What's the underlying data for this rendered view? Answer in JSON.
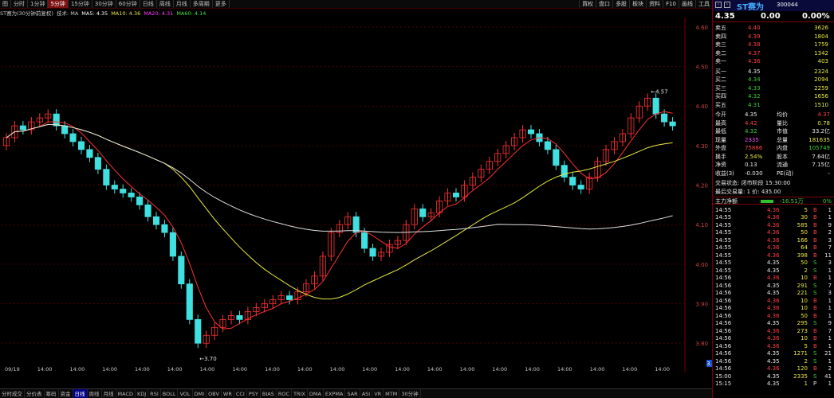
{
  "topbar": {
    "tabs": [
      "图",
      "分时",
      "1分钟",
      "5分钟",
      "15分钟",
      "30分钟",
      "60分钟",
      "日线",
      "周线",
      "月线",
      "多周期",
      "更多"
    ],
    "tools": [
      "買权",
      "盘口",
      "多股",
      "板块",
      "资料",
      "F10",
      "画线",
      "工具"
    ]
  },
  "indicator_line": [
    {
      "text": "ST赛为(30分钟前复权)",
      "color": "#c8c8c8"
    },
    {
      "text": "技术: MA",
      "color": "#c8c8c8"
    },
    {
      "text": "MA5: 4.35",
      "color": "#ffffff"
    },
    {
      "text": "MA10: 4.36",
      "color": "#e8e840"
    },
    {
      "text": "MA20: 4.31",
      "color": "#ff40ff"
    },
    {
      "text": "MA60: 4.14",
      "color": "#40e040"
    }
  ],
  "chart_data": {
    "type": "candlestick",
    "ylim": [
      3.75,
      4.62
    ],
    "y_ticks": [
      3.8,
      3.9,
      4.0,
      4.1,
      4.2,
      4.3,
      4.4,
      4.5,
      4.6
    ],
    "x_ticks": [
      "09/19",
      "14:00",
      "14:00",
      "14:00",
      "14:00",
      "14:00",
      "14:00",
      "14:00",
      "14:00",
      "14:00",
      "14:00",
      "14:00",
      "14:00",
      "14:00",
      "14:00",
      "14:00",
      "14:00",
      "14:00",
      "14:00",
      "14:00",
      "14:00"
    ],
    "high_label": "4.57",
    "low_label": "3.70",
    "current_price_tag": "3.72",
    "series_close": [
      4.32,
      4.35,
      4.34,
      4.36,
      4.37,
      4.38,
      4.35,
      4.33,
      4.31,
      4.29,
      4.27,
      4.24,
      4.2,
      4.19,
      4.18,
      4.17,
      4.15,
      4.12,
      4.1,
      4.08,
      4.02,
      3.95,
      3.86,
      3.8,
      3.82,
      3.84,
      3.86,
      3.87,
      3.86,
      3.88,
      3.89,
      3.9,
      3.91,
      3.92,
      3.91,
      3.93,
      3.95,
      3.97,
      4.02,
      4.08,
      4.1,
      4.12,
      4.08,
      4.04,
      4.02,
      4.03,
      4.05,
      4.06,
      4.1,
      4.14,
      4.12,
      4.13,
      4.16,
      4.18,
      4.17,
      4.2,
      4.22,
      4.24,
      4.26,
      4.28,
      4.3,
      4.32,
      4.34,
      4.33,
      4.31,
      4.29,
      4.25,
      4.22,
      4.2,
      4.19,
      4.22,
      4.26,
      4.29,
      4.31,
      4.33,
      4.37,
      4.4,
      4.42,
      4.38,
      4.36,
      4.35
    ]
  },
  "panel": {
    "name": "ST赛为",
    "code": "300044",
    "price": "4.35",
    "change": "0.00",
    "change_pct": "0.00%",
    "asks": [
      {
        "label": "卖五",
        "price": "4.40",
        "vol": "3626"
      },
      {
        "label": "卖四",
        "price": "4.39",
        "vol": "1804"
      },
      {
        "label": "卖三",
        "price": "4.38",
        "vol": "1759"
      },
      {
        "label": "卖二",
        "price": "4.37",
        "vol": "1342"
      },
      {
        "label": "卖一",
        "price": "4.36",
        "vol": "403"
      }
    ],
    "bids": [
      {
        "label": "买一",
        "price": "4.35",
        "vol": "2324"
      },
      {
        "label": "买二",
        "price": "4.34",
        "vol": "2094"
      },
      {
        "label": "买三",
        "price": "4.33",
        "vol": "2259"
      },
      {
        "label": "买四",
        "price": "4.32",
        "vol": "1656"
      },
      {
        "label": "买五",
        "price": "4.31",
        "vol": "1510"
      }
    ],
    "stats": [
      {
        "l1": "今开",
        "v1": "4.35",
        "l2": "均价",
        "v2": "4.37",
        "c1": "white",
        "c2": "red"
      },
      {
        "l1": "最高",
        "v1": "4.42",
        "l2": "量比",
        "v2": "0.78",
        "c1": "red",
        "c2": "yellow"
      },
      {
        "l1": "最低",
        "v1": "4.32",
        "l2": "市值",
        "v2": "33.2亿",
        "c1": "green",
        "c2": "white"
      },
      {
        "l1": "现量",
        "v1": "2335",
        "l2": "总量",
        "v2": "181635",
        "c1": "magenta",
        "c2": "yellow"
      },
      {
        "l1": "外盘",
        "v1": "75886",
        "l2": "内盘",
        "v2": "105749",
        "c1": "red",
        "c2": "green"
      },
      {
        "l1": "换手",
        "v1": "2.54%",
        "l2": "股本",
        "v2": "7.64亿",
        "c1": "yellow",
        "c2": "white"
      },
      {
        "l1": "净资",
        "v1": "0.13",
        "l2": "流通",
        "v2": "7.15亿",
        "c1": "white",
        "c2": "white"
      },
      {
        "l1": "收益(3)",
        "v1": "-0.030",
        "l2": "PE(动)",
        "v2": "-",
        "c1": "white",
        "c2": "white"
      }
    ],
    "trading_status": "交易状态: 闭市阶段 15:30:00",
    "last_trade": "最后交易量: 1   价: 435.00",
    "main_flow_label": "主力净额",
    "main_flow_value": "-16.51万",
    "main_flow_pct": "0%",
    "ticks": [
      {
        "t": "14:55",
        "p": "4.36",
        "v": "5",
        "d": "B",
        "n": "1"
      },
      {
        "t": "14:55",
        "p": "4.36",
        "v": "30",
        "d": "B",
        "n": "1"
      },
      {
        "t": "14:55",
        "p": "4.36",
        "v": "585",
        "d": "B",
        "n": "9"
      },
      {
        "t": "14:55",
        "p": "4.36",
        "v": "50",
        "d": "B",
        "n": "2"
      },
      {
        "t": "14:55",
        "p": "4.36",
        "v": "166",
        "d": "B",
        "n": "3"
      },
      {
        "t": "14:55",
        "p": "4.36",
        "v": "64",
        "d": "B",
        "n": "7"
      },
      {
        "t": "14:55",
        "p": "4.36",
        "v": "398",
        "d": "B",
        "n": "11"
      },
      {
        "t": "14:55",
        "p": "4.35",
        "v": "50",
        "d": "S",
        "n": "3"
      },
      {
        "t": "14:55",
        "p": "4.35",
        "v": "2",
        "d": "S",
        "n": "1"
      },
      {
        "t": "14:56",
        "p": "4.36",
        "v": "10",
        "d": "B",
        "n": "1"
      },
      {
        "t": "14:56",
        "p": "4.35",
        "v": "291",
        "d": "S",
        "n": "7"
      },
      {
        "t": "14:56",
        "p": "4.35",
        "v": "221",
        "d": "S",
        "n": "3"
      },
      {
        "t": "14:56",
        "p": "4.36",
        "v": "10",
        "d": "B",
        "n": "1"
      },
      {
        "t": "14:56",
        "p": "4.36",
        "v": "10",
        "d": "B",
        "n": "1"
      },
      {
        "t": "14:56",
        "p": "4.36",
        "v": "50",
        "d": "B",
        "n": "1"
      },
      {
        "t": "14:56",
        "p": "4.35",
        "v": "295",
        "d": "S",
        "n": "9"
      },
      {
        "t": "14:56",
        "p": "4.36",
        "v": "273",
        "d": "B",
        "n": "7"
      },
      {
        "t": "14:56",
        "p": "4.36",
        "v": "10",
        "d": "B",
        "n": "1"
      },
      {
        "t": "14:56",
        "p": "4.36",
        "v": "5",
        "d": "B",
        "n": "1"
      },
      {
        "t": "14:56",
        "p": "4.35",
        "v": "1271",
        "d": "S",
        "n": "21"
      },
      {
        "t": "14:56",
        "p": "4.35",
        "v": "2",
        "d": "S",
        "n": "1"
      },
      {
        "t": "14:56",
        "p": "4.36",
        "v": "120",
        "d": "B",
        "n": "2"
      },
      {
        "t": "15:00",
        "p": "4.35",
        "v": "2335",
        "d": "S",
        "n": "41"
      },
      {
        "t": "15:15",
        "p": "4.35",
        "v": "1",
        "d": "P",
        "n": "1"
      }
    ]
  },
  "bottombar": [
    "分时成交",
    "分价表",
    "筹码",
    "资金",
    "日线",
    "周线",
    "月线",
    "MACD",
    "KDJ",
    "RSI",
    "BOLL",
    "VOL",
    "DMI",
    "OBV",
    "WR",
    "CCI",
    "PSY",
    "BIAS",
    "ROC",
    "TRIX",
    "DMA",
    "EXPMA",
    "SAR",
    "ASI",
    "VR",
    "MTM",
    "30分钟"
  ]
}
